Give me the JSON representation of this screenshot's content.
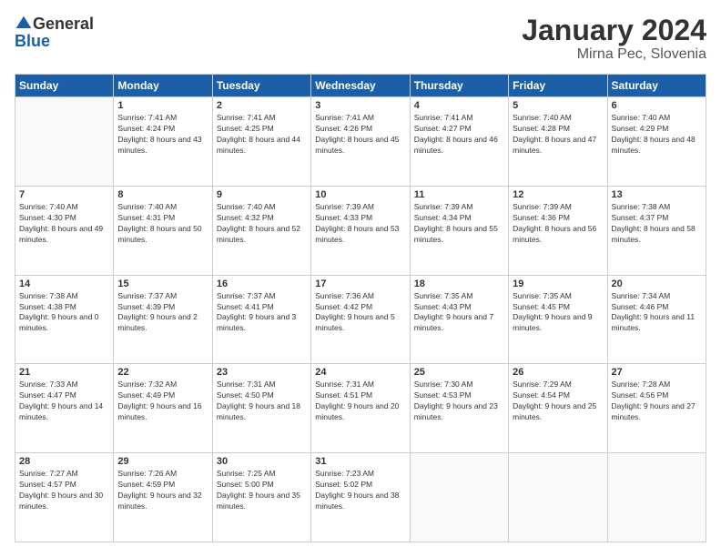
{
  "logo": {
    "general": "General",
    "blue": "Blue"
  },
  "header": {
    "title": "January 2024",
    "subtitle": "Mirna Pec, Slovenia"
  },
  "weekdays": [
    "Sunday",
    "Monday",
    "Tuesday",
    "Wednesday",
    "Thursday",
    "Friday",
    "Saturday"
  ],
  "weeks": [
    [
      {
        "day": "",
        "empty": true
      },
      {
        "day": "1",
        "sunrise": "7:41 AM",
        "sunset": "4:24 PM",
        "daylight": "8 hours and 43 minutes."
      },
      {
        "day": "2",
        "sunrise": "7:41 AM",
        "sunset": "4:25 PM",
        "daylight": "8 hours and 44 minutes."
      },
      {
        "day": "3",
        "sunrise": "7:41 AM",
        "sunset": "4:26 PM",
        "daylight": "8 hours and 45 minutes."
      },
      {
        "day": "4",
        "sunrise": "7:41 AM",
        "sunset": "4:27 PM",
        "daylight": "8 hours and 46 minutes."
      },
      {
        "day": "5",
        "sunrise": "7:40 AM",
        "sunset": "4:28 PM",
        "daylight": "8 hours and 47 minutes."
      },
      {
        "day": "6",
        "sunrise": "7:40 AM",
        "sunset": "4:29 PM",
        "daylight": "8 hours and 48 minutes."
      }
    ],
    [
      {
        "day": "7",
        "sunrise": "7:40 AM",
        "sunset": "4:30 PM",
        "daylight": "8 hours and 49 minutes."
      },
      {
        "day": "8",
        "sunrise": "7:40 AM",
        "sunset": "4:31 PM",
        "daylight": "8 hours and 50 minutes."
      },
      {
        "day": "9",
        "sunrise": "7:40 AM",
        "sunset": "4:32 PM",
        "daylight": "8 hours and 52 minutes."
      },
      {
        "day": "10",
        "sunrise": "7:39 AM",
        "sunset": "4:33 PM",
        "daylight": "8 hours and 53 minutes."
      },
      {
        "day": "11",
        "sunrise": "7:39 AM",
        "sunset": "4:34 PM",
        "daylight": "8 hours and 55 minutes."
      },
      {
        "day": "12",
        "sunrise": "7:39 AM",
        "sunset": "4:36 PM",
        "daylight": "8 hours and 56 minutes."
      },
      {
        "day": "13",
        "sunrise": "7:38 AM",
        "sunset": "4:37 PM",
        "daylight": "8 hours and 58 minutes."
      }
    ],
    [
      {
        "day": "14",
        "sunrise": "7:38 AM",
        "sunset": "4:38 PM",
        "daylight": "9 hours and 0 minutes."
      },
      {
        "day": "15",
        "sunrise": "7:37 AM",
        "sunset": "4:39 PM",
        "daylight": "9 hours and 2 minutes."
      },
      {
        "day": "16",
        "sunrise": "7:37 AM",
        "sunset": "4:41 PM",
        "daylight": "9 hours and 3 minutes."
      },
      {
        "day": "17",
        "sunrise": "7:36 AM",
        "sunset": "4:42 PM",
        "daylight": "9 hours and 5 minutes."
      },
      {
        "day": "18",
        "sunrise": "7:35 AM",
        "sunset": "4:43 PM",
        "daylight": "9 hours and 7 minutes."
      },
      {
        "day": "19",
        "sunrise": "7:35 AM",
        "sunset": "4:45 PM",
        "daylight": "9 hours and 9 minutes."
      },
      {
        "day": "20",
        "sunrise": "7:34 AM",
        "sunset": "4:46 PM",
        "daylight": "9 hours and 11 minutes."
      }
    ],
    [
      {
        "day": "21",
        "sunrise": "7:33 AM",
        "sunset": "4:47 PM",
        "daylight": "9 hours and 14 minutes."
      },
      {
        "day": "22",
        "sunrise": "7:32 AM",
        "sunset": "4:49 PM",
        "daylight": "9 hours and 16 minutes."
      },
      {
        "day": "23",
        "sunrise": "7:31 AM",
        "sunset": "4:50 PM",
        "daylight": "9 hours and 18 minutes."
      },
      {
        "day": "24",
        "sunrise": "7:31 AM",
        "sunset": "4:51 PM",
        "daylight": "9 hours and 20 minutes."
      },
      {
        "day": "25",
        "sunrise": "7:30 AM",
        "sunset": "4:53 PM",
        "daylight": "9 hours and 23 minutes."
      },
      {
        "day": "26",
        "sunrise": "7:29 AM",
        "sunset": "4:54 PM",
        "daylight": "9 hours and 25 minutes."
      },
      {
        "day": "27",
        "sunrise": "7:28 AM",
        "sunset": "4:56 PM",
        "daylight": "9 hours and 27 minutes."
      }
    ],
    [
      {
        "day": "28",
        "sunrise": "7:27 AM",
        "sunset": "4:57 PM",
        "daylight": "9 hours and 30 minutes."
      },
      {
        "day": "29",
        "sunrise": "7:26 AM",
        "sunset": "4:59 PM",
        "daylight": "9 hours and 32 minutes."
      },
      {
        "day": "30",
        "sunrise": "7:25 AM",
        "sunset": "5:00 PM",
        "daylight": "9 hours and 35 minutes."
      },
      {
        "day": "31",
        "sunrise": "7:23 AM",
        "sunset": "5:02 PM",
        "daylight": "9 hours and 38 minutes."
      },
      {
        "day": "",
        "empty": true
      },
      {
        "day": "",
        "empty": true
      },
      {
        "day": "",
        "empty": true
      }
    ]
  ],
  "labels": {
    "sunrise": "Sunrise:",
    "sunset": "Sunset:",
    "daylight": "Daylight:"
  }
}
